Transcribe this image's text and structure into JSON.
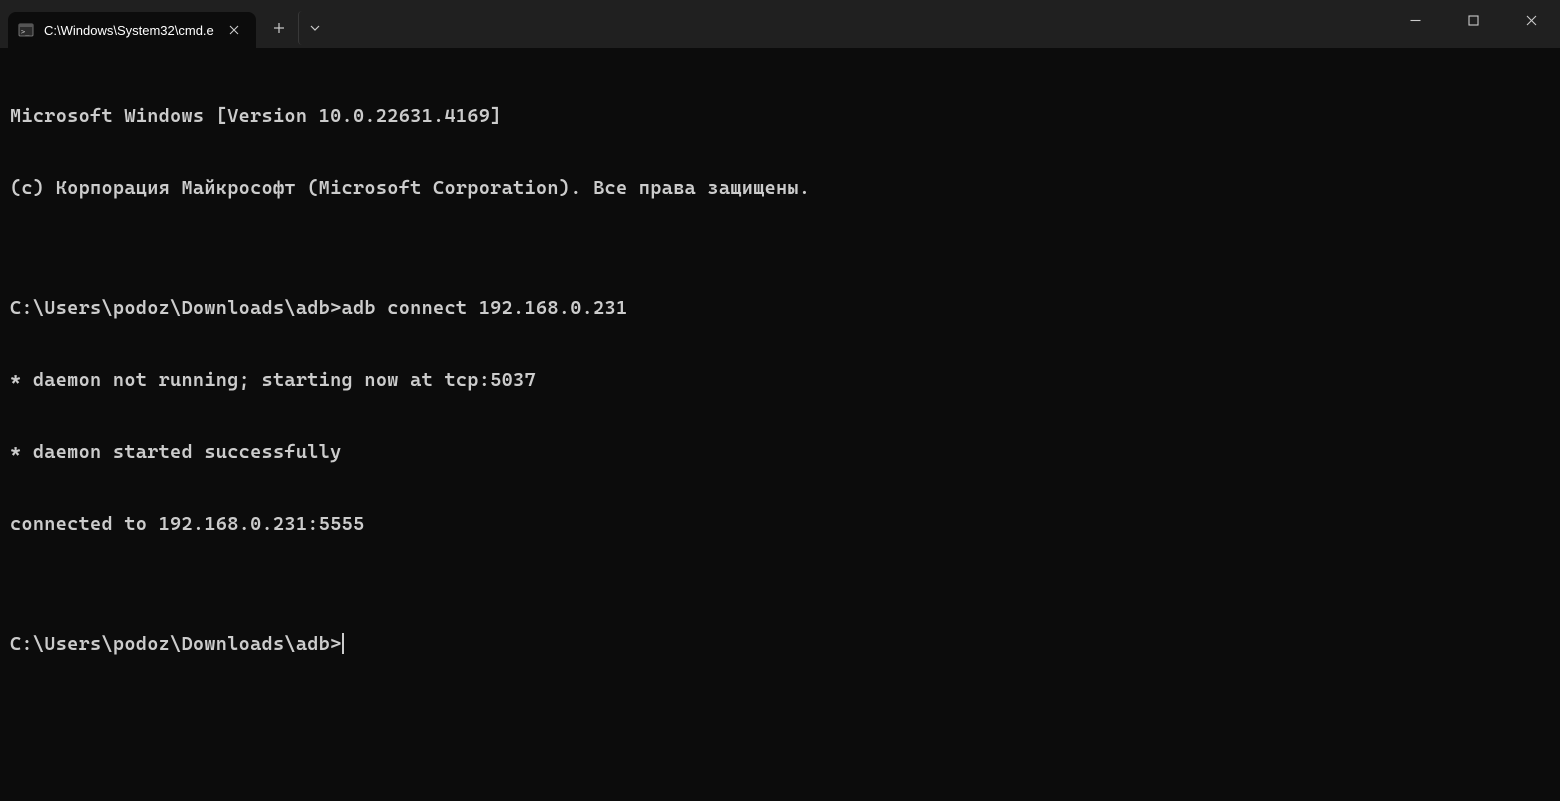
{
  "titlebar": {
    "tab_title": "C:\\Windows\\System32\\cmd.e"
  },
  "terminal": {
    "lines": [
      "Microsoft Windows [Version 10.0.22631.4169]",
      "(c) Корпорация Майкрософт (Microsoft Corporation). Все права защищены.",
      "",
      "C:\\Users\\podoz\\Downloads\\adb>adb connect 192.168.0.231",
      "* daemon not running; starting now at tcp:5037",
      "* daemon started successfully",
      "connected to 192.168.0.231:5555",
      ""
    ],
    "current_prompt": "C:\\Users\\podoz\\Downloads\\adb>"
  }
}
